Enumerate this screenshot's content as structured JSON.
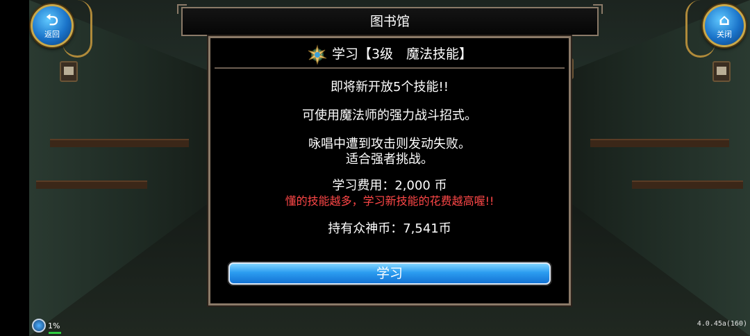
{
  "nav": {
    "back_icon": "back-arrow-icon",
    "back_label": "返回",
    "close_icon": "home-icon",
    "close_label": "关闭"
  },
  "title": "图书馆",
  "panel": {
    "header_icon": "magic-skill-icon",
    "header": "学习【3级　魔法技能】",
    "lines": [
      "即将新开放5个技能!!",
      "可使用魔法师的强力战斗招式。",
      "咏唱中遭到攻击则发动失败。",
      "适合强者挑战。",
      "学习费用：2,000 币",
      "懂的技能越多，学习新技能的花费越高喔!!",
      "持有众神币：7,541币"
    ]
  },
  "learn_button": "学习",
  "status": {
    "percent": "1%",
    "version": "4.0.45a(160)"
  },
  "colors": {
    "button_blue": "#2b9cf0",
    "warning_red": "#ff4747",
    "frame": "#8b7a68"
  }
}
